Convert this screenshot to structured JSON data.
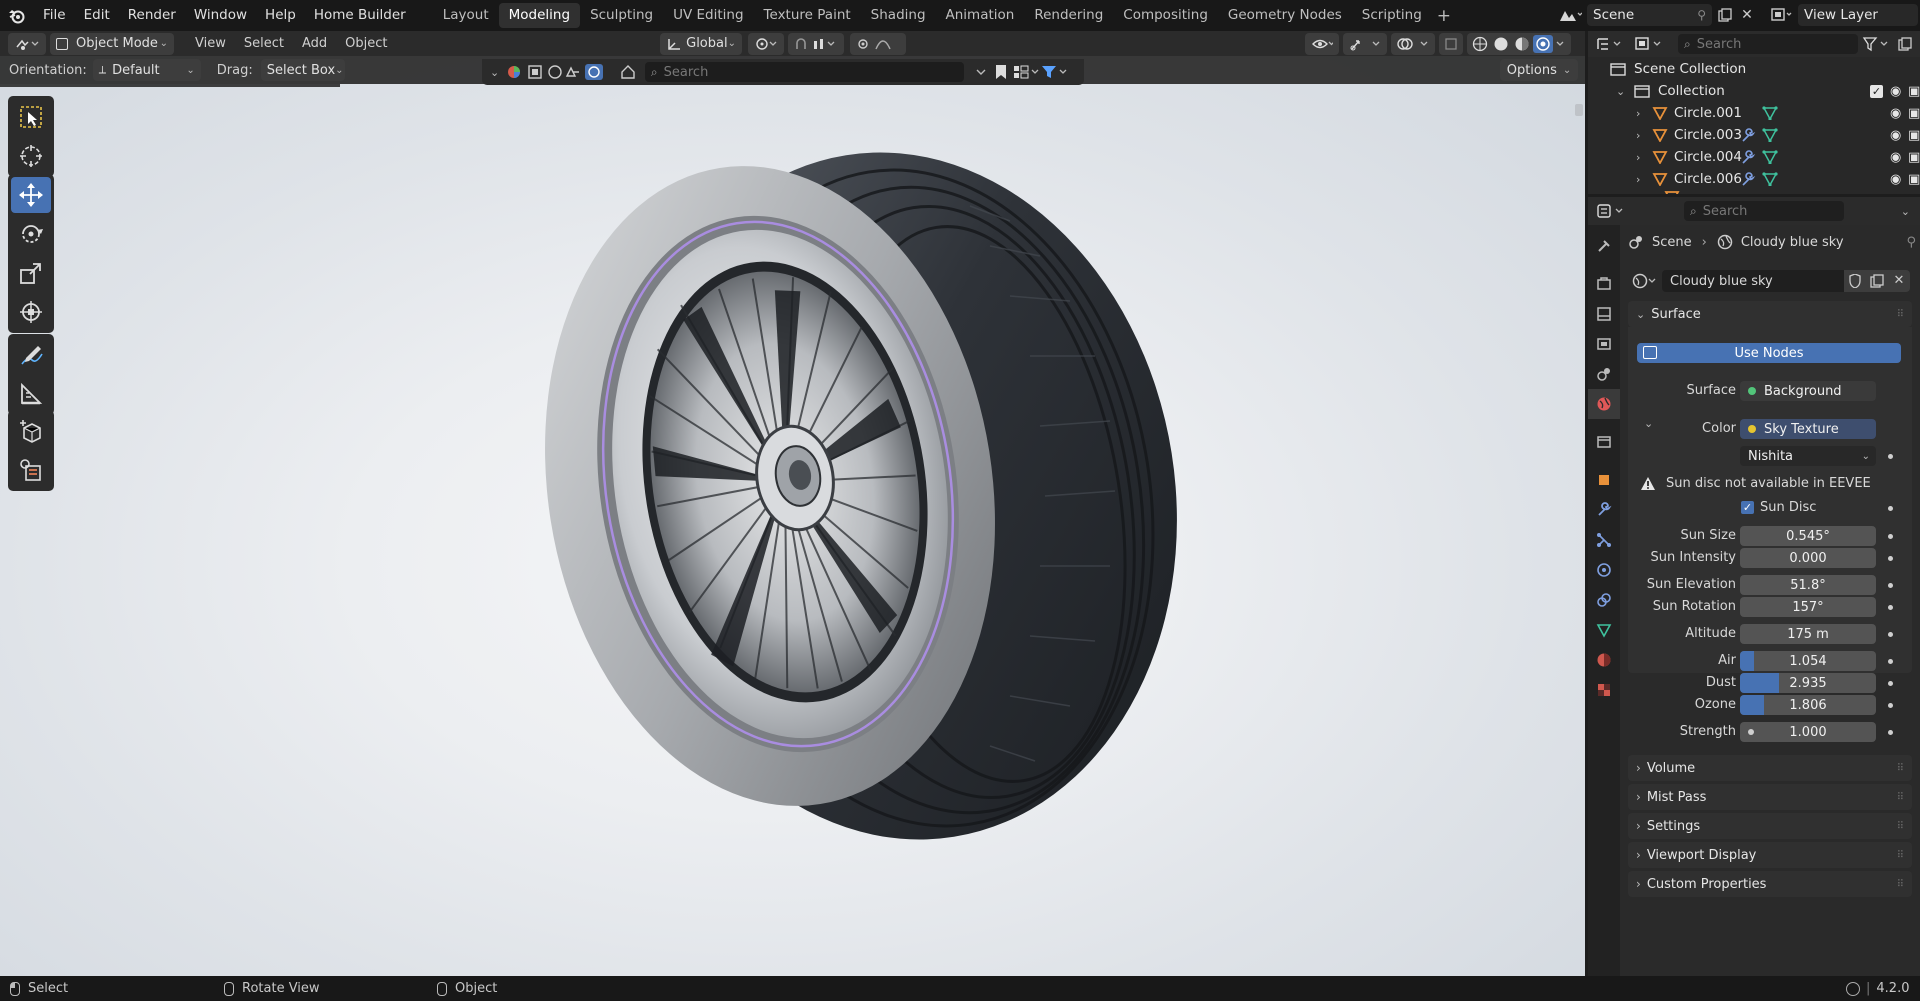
{
  "topbar": {
    "menus": [
      "File",
      "Edit",
      "Render",
      "Window",
      "Help",
      "Home Builder"
    ],
    "workspaces": [
      "Layout",
      "Modeling",
      "Sculpting",
      "UV Editing",
      "Texture Paint",
      "Shading",
      "Animation",
      "Rendering",
      "Compositing",
      "Geometry Nodes",
      "Scripting"
    ],
    "active_workspace": "Modeling",
    "scene": "Scene",
    "view_layer": "View Layer"
  },
  "viewport_header": {
    "mode": "Object Mode",
    "menus": [
      "View",
      "Select",
      "Add",
      "Object"
    ],
    "transform_orientation": "Global"
  },
  "tool_header": {
    "orientation_label": "Orientation:",
    "orientation_value": "Default",
    "drag_label": "Drag:",
    "drag_value": "Select Box",
    "options_label": "Options",
    "search_placeholder": "Search"
  },
  "outliner": {
    "search_placeholder": "Search",
    "root": "Scene Collection",
    "collection": "Collection",
    "objects": [
      "Circle.001",
      "Circle.003",
      "Circle.004",
      "Circle.006"
    ]
  },
  "properties": {
    "search_placeholder": "Search",
    "breadcrumb_scene": "Scene",
    "breadcrumb_world": "Cloudy blue sky",
    "world_name": "Cloudy blue sky",
    "surface_panel": "Surface",
    "use_nodes_label": "Use Nodes",
    "surface_label": "Surface",
    "surface_value": "Background",
    "color_label": "Color",
    "color_value": "Sky Texture",
    "sky_type": "Nishita",
    "warning": "Sun disc not available in EEVEE",
    "sun_disc_label": "Sun Disc",
    "sun_disc_checked": true,
    "fields": [
      {
        "label": "Sun Size",
        "value": "0.545°"
      },
      {
        "label": "Sun Intensity",
        "value": "0.000"
      },
      {
        "label": "Sun Elevation",
        "value": "51.8°"
      },
      {
        "label": "Sun Rotation",
        "value": "157°"
      },
      {
        "label": "Altitude",
        "value": "175 m"
      }
    ],
    "sliders": [
      {
        "label": "Air",
        "value": "1.054",
        "fraction": 0.1
      },
      {
        "label": "Dust",
        "value": "2.935",
        "fraction": 0.29
      },
      {
        "label": "Ozone",
        "value": "1.806",
        "fraction": 0.18
      }
    ],
    "strength_label": "Strength",
    "strength_value": "1.000",
    "collapsed_panels": [
      "Volume",
      "Mist Pass",
      "Settings",
      "Viewport Display",
      "Custom Properties"
    ]
  },
  "statusbar": {
    "select": "Select",
    "rotate": "Rotate View",
    "object": "Object",
    "version": "4.2.0"
  },
  "colors": {
    "accent": "#4772b3",
    "object_orange": "#e8913a",
    "mesh_green": "#3fc29e",
    "modifier_blue": "#7f9fe0"
  }
}
